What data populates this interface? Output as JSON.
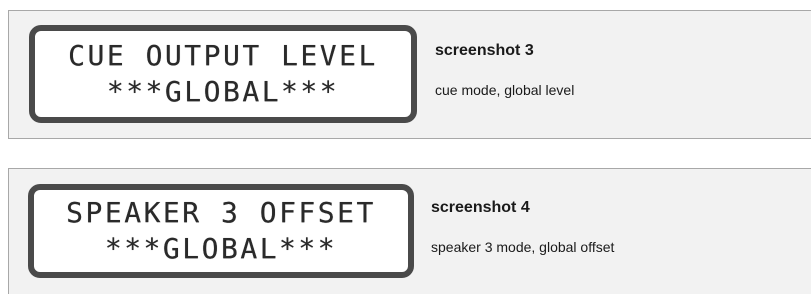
{
  "screens": [
    {
      "lcd_line1": "CUE OUTPUT LEVEL",
      "lcd_line2": "***GLOBAL***",
      "title": "screenshot 3",
      "description": "cue mode, global level"
    },
    {
      "lcd_line1": "SPEAKER 3 OFFSET",
      "lcd_line2": "***GLOBAL***",
      "title": "screenshot 4",
      "description": "speaker 3 mode,  global offset"
    }
  ],
  "colors": {
    "panel_background": "#f2f2f2",
    "panel_border": "#a8a8a8",
    "lcd_frame": "#4a4a4a",
    "lcd_text": "#2a2a2a"
  }
}
